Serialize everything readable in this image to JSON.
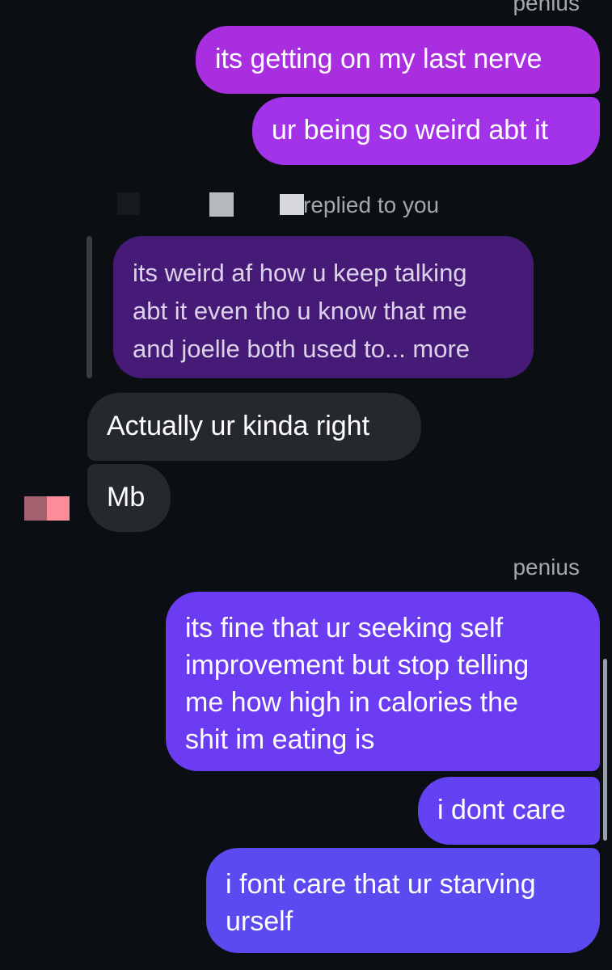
{
  "thread": {
    "top_sender_label": "penius",
    "messages_top": [
      {
        "text": "its getting on my last nerve"
      },
      {
        "text": "ur being so weird abt it"
      }
    ],
    "reply_notice": {
      "label": "replied to you",
      "quoted_text_line1": "its weird af how u keep talking",
      "quoted_text_line2": "abt it even tho u know that me",
      "quoted_text_line3": "and joelle both used to... more"
    },
    "incoming": [
      {
        "text": "Actually ur kinda right"
      },
      {
        "text": "Mb"
      }
    ],
    "bottom_sender_label": "penius",
    "messages_bottom": [
      {
        "line1": "its fine that ur seeking self",
        "line2": "improvement but stop telling",
        "line3": "me how high in calories the",
        "line4": "shit im eating is"
      },
      {
        "text": "i dont care"
      },
      {
        "line1": "i font care that ur starving",
        "line2": "urself"
      }
    ]
  },
  "colors": {
    "background": "#0b0f13",
    "outgoing_magenta": "#a52fe0",
    "outgoing_violet": "#6d40f5",
    "outgoing_blue_violet": "#5a4cf0",
    "incoming_gray": "#25282c",
    "quoted_purple": "#461b78",
    "meta_gray": "#a4a8ae"
  }
}
